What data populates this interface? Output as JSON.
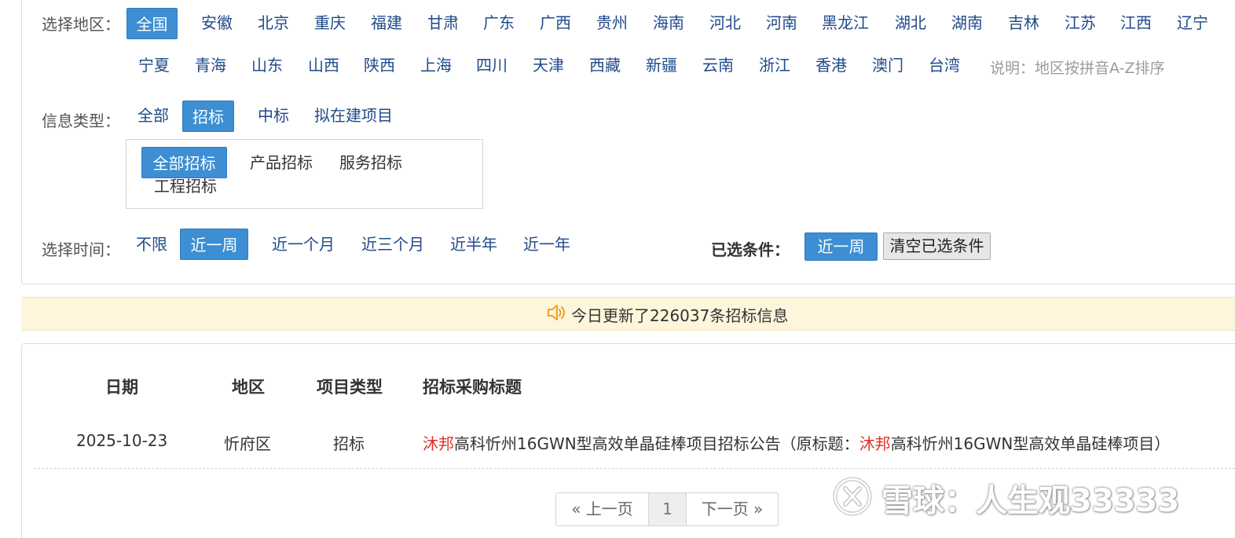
{
  "region": {
    "label": "选择地区：",
    "options": [
      "全国",
      "安徽",
      "北京",
      "重庆",
      "福建",
      "甘肃",
      "广东",
      "广西",
      "贵州",
      "海南",
      "河北",
      "河南",
      "黑龙江",
      "湖北",
      "湖南",
      "吉林",
      "江苏",
      "江西",
      "辽宁",
      "宁夏",
      "青海",
      "山东",
      "山西",
      "陕西",
      "上海",
      "四川",
      "天津",
      "西藏",
      "新疆",
      "云南",
      "浙江",
      "香港",
      "澳门",
      "台湾"
    ],
    "selected": "全国",
    "note": "说明：地区按拼音A-Z排序"
  },
  "info_type": {
    "label": "信息类型：",
    "options": [
      "全部",
      "招标",
      "中标",
      "拟在建项目"
    ],
    "selected": "招标",
    "sub_options": [
      "全部招标",
      "产品招标",
      "服务招标",
      "工程招标"
    ],
    "sub_selected": "全部招标"
  },
  "time": {
    "label": "选择时间：",
    "options": [
      "不限",
      "近一周",
      "近一个月",
      "近三个月",
      "近半年",
      "近一年"
    ],
    "selected": "近一周"
  },
  "conditions": {
    "label": "已选条件：",
    "tag": "近一周",
    "clear_label": "清空已选条件"
  },
  "notice": {
    "icon": "speaker-icon",
    "text": "今日更新了226037条招标信息"
  },
  "table": {
    "headers": [
      "日期",
      "地区",
      "项目类型",
      "招标采购标题"
    ],
    "rows": [
      {
        "date": "2025-10-23",
        "region": "忻府区",
        "type": "招标",
        "title_hl1": "沐邦",
        "title_part1": "高科忻州16GWN型高效单晶硅棒项目招标公告（原标题：",
        "title_hl2": "沐邦",
        "title_part2": "高科忻州16GWN型高效单晶硅棒项目）"
      }
    ]
  },
  "pagination": {
    "prev": "« 上一页",
    "current": "1",
    "next": "下一页 »"
  },
  "watermark": {
    "text": "雪球：人生观33333"
  },
  "colors": {
    "accent": "#3d8ed3",
    "link": "#1f4a8a",
    "highlight": "#e0302b",
    "notice_bg": "#fdf5dc"
  }
}
